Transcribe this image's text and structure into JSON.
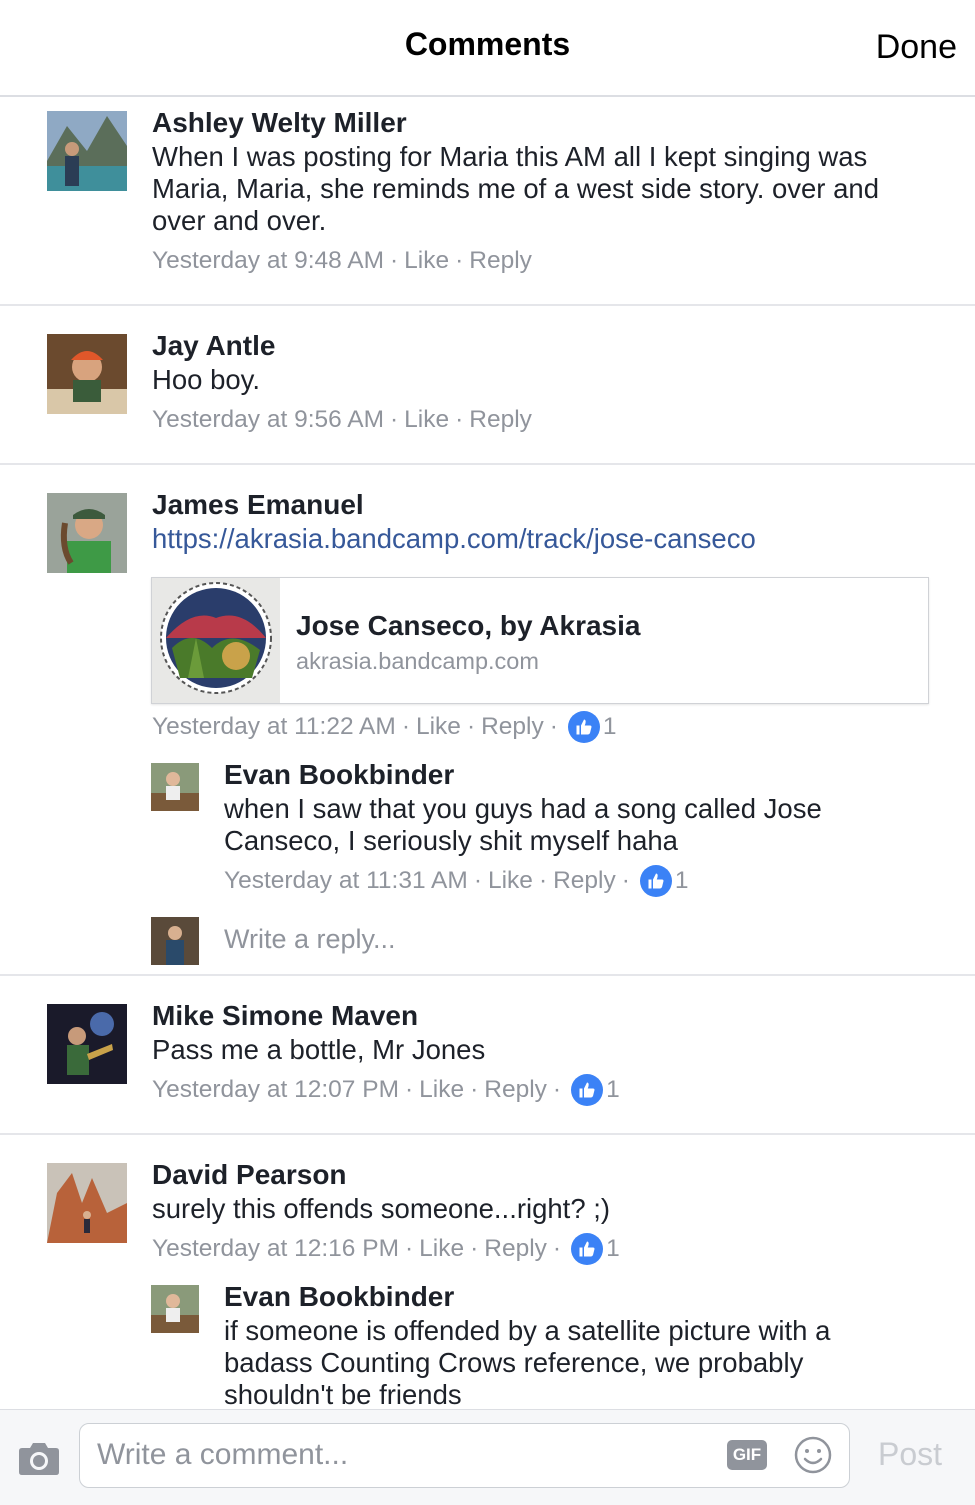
{
  "header": {
    "title": "Comments",
    "done_label": "Done"
  },
  "comments": [
    {
      "author": "Ashley Welty Miller",
      "text": "When I was posting for Maria this AM all I kept singing was Maria, Maria, she reminds me of a west side story. over and over and over.",
      "time": "Yesterday at 9:48 AM",
      "like_label": "Like",
      "reply_label": "Reply"
    },
    {
      "author": "Jay Antle",
      "text": "Hoo boy.",
      "time": "Yesterday at 9:56 AM",
      "like_label": "Like",
      "reply_label": "Reply"
    },
    {
      "author": "James Emanuel",
      "text": "https://akrasia.bandcamp.com/track/jose-canseco",
      "link_card": {
        "title": "Jose Canseco, by Akrasia",
        "domain": "akrasia.bandcamp.com"
      },
      "time": "Yesterday at 11:22 AM",
      "like_label": "Like",
      "reply_label": "Reply",
      "reactions": "1",
      "replies": [
        {
          "author": "Evan Bookbinder",
          "text": "when I saw that you guys had a song called Jose Canseco, I seriously shit myself haha",
          "time": "Yesterday at 11:31 AM",
          "like_label": "Like",
          "reply_label": "Reply",
          "reactions": "1"
        }
      ],
      "write_reply_placeholder": "Write a reply..."
    },
    {
      "author": "Mike Simone Maven",
      "text": "Pass me a bottle, Mr Jones",
      "time": "Yesterday at 12:07 PM",
      "like_label": "Like",
      "reply_label": "Reply",
      "reactions": "1"
    },
    {
      "author": "David Pearson",
      "text": "surely this offends someone...right? ;)",
      "time": "Yesterday at 12:16 PM",
      "like_label": "Like",
      "reply_label": "Reply",
      "reactions": "1",
      "replies": [
        {
          "author": "Evan Bookbinder",
          "text": "if someone is offended by a satellite picture with a badass Counting Crows reference, we probably shouldn't be friends"
        }
      ]
    }
  ],
  "composer": {
    "placeholder": "Write a comment...",
    "gif_label": "GIF",
    "post_label": "Post"
  },
  "colors": {
    "link": "#365899",
    "meta": "#90949c",
    "like_bubble": "#3b82f6",
    "divider": "#e5e6ea"
  },
  "icons": [
    "camera-icon",
    "gif-icon",
    "emoji-icon",
    "thumbs-up-icon"
  ]
}
